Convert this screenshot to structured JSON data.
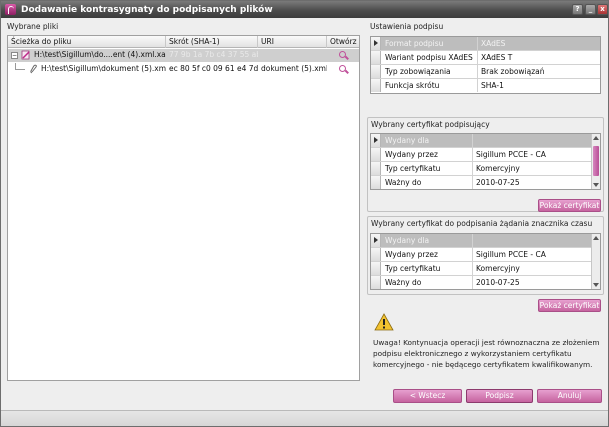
{
  "window": {
    "title": "Dodawanie kontrasygnaty do podpisanych plików",
    "help_glyph": "?",
    "minimize_glyph": "_",
    "close_glyph": "x"
  },
  "files": {
    "section_label": "Wybrane pliki",
    "columns": [
      "Ścieżka do pliku",
      "Skrót (SHA-1)",
      "URI",
      "Otwórz"
    ],
    "rows": [
      {
        "path": "H:\\test\\Sigillum\\do....ent (4).xml.xades",
        "hash": "77 9b 1a 7b c4 37 55 ab ...",
        "uri": ""
      },
      {
        "path": "H:\\test\\Sigillum\\dokument (5).xml",
        "hash": "ec 80 5f c0 09 61 e4 7d ...",
        "uri": "dokument (5).xml"
      }
    ]
  },
  "signature_settings": {
    "title": "Ustawienia podpisu",
    "rows": [
      {
        "key": "Format podpisu",
        "value": "XAdES"
      },
      {
        "key": "Wariant podpisu XAdES",
        "value": "XAdES T"
      },
      {
        "key": "Typ zobowiązania",
        "value": "Brak zobowiązań"
      },
      {
        "key": "Funkcja skrótu",
        "value": "SHA-1"
      }
    ]
  },
  "signing_cert": {
    "title": "Wybrany certyfikat podpisujący",
    "rows": [
      {
        "key": "Wydany dla",
        "value": ""
      },
      {
        "key": "Wydany przez",
        "value": "Sigillum PCCE - CA"
      },
      {
        "key": "Typ certyfikatu",
        "value": "Komercyjny"
      },
      {
        "key": "Ważny do",
        "value": "2010-07-25"
      }
    ],
    "button": "Pokaż certyfikat"
  },
  "timestamp_cert": {
    "title": "Wybrany certyfikat do podpisania żądania znacznika czasu",
    "rows": [
      {
        "key": "Wydany dla",
        "value": ""
      },
      {
        "key": "Wydany przez",
        "value": "Sigillum PCCE - CA"
      },
      {
        "key": "Typ certyfikatu",
        "value": "Komercyjny"
      },
      {
        "key": "Ważny do",
        "value": "2010-07-25"
      }
    ],
    "button": "Pokaż certyfikat"
  },
  "warning": {
    "text": "Uwaga! Kontynuacja operacji jest równoznaczna ze złożeniem podpisu elektronicznego z wykorzystaniem certyfikatu komercyjnego - nie będącego certyfikatem kwalifikowanym."
  },
  "buttons": {
    "back": "< Wstecz",
    "sign": "Podpisz",
    "cancel": "Anuluj"
  }
}
